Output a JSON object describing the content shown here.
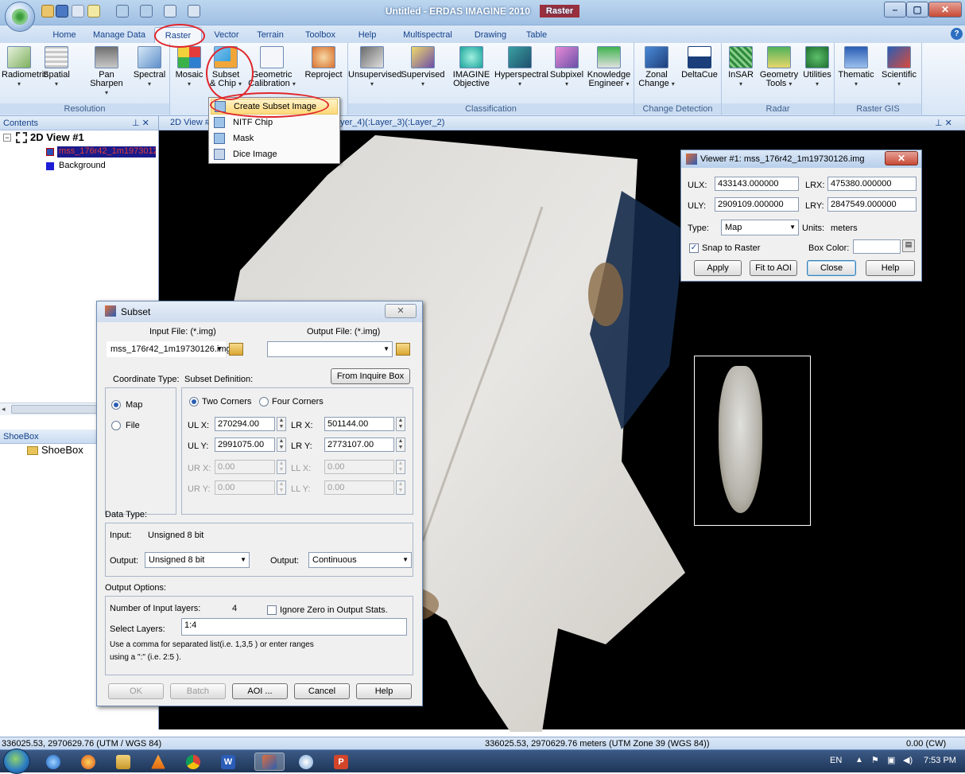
{
  "window": {
    "title": "Untitled - ERDAS IMAGINE 2010",
    "context_tab": "Raster"
  },
  "tabs": [
    "Home",
    "Manage Data",
    "Raster",
    "Vector",
    "Terrain",
    "Toolbox",
    "Help",
    "Multispectral",
    "Drawing",
    "Table"
  ],
  "ribbon": {
    "groups": {
      "resolution": "Resolution",
      "classification": "Classification",
      "change_detection": "Change Detection",
      "radar": "Radar",
      "raster_gis": "Raster GIS"
    },
    "buttons": {
      "radiometric": "Radiometric",
      "spatial": "Spatial",
      "pan": "Pan",
      "sharpen": "Sharpen",
      "spectral": "Spectral",
      "mosaic": "Mosaic",
      "subset": "Subset",
      "chip": "& Chip",
      "geometric": "Geometric",
      "calibration": "Calibration",
      "reproject": "Reproject",
      "unsupervised": "Unsupervised",
      "supervised": "Supervised",
      "imagine": "IMAGINE",
      "objective": "Objective",
      "hyperspectral": "Hyperspectral",
      "subpixel": "Subpixel",
      "knowledge": "Knowledge",
      "engineer": "Engineer",
      "zonal": "Zonal",
      "change": "Change",
      "deltacue": "DeltaCue",
      "insar": "InSAR",
      "geometry": "Geometry",
      "tools": "Tools",
      "utilities": "Utilities",
      "thematic": "Thematic",
      "scientific": "Scientific"
    }
  },
  "subset_menu": [
    "Create Subset Image",
    "NITF Chip",
    "Mask",
    "Dice Image"
  ],
  "contents": {
    "header": "Contents",
    "view": "2D View #1",
    "layer": "mss_176r42_1m19730126",
    "background": "Background"
  },
  "view_tab": {
    "name": "2D View #",
    "layers": "yer_4)(:Layer_3)(:Layer_2)"
  },
  "shoebox": {
    "header": "ShoeBox",
    "item": "ShoeBox"
  },
  "viewer": {
    "title": "Viewer #1: mss_176r42_1m19730126.img",
    "ulx_label": "ULX:",
    "ulx": "433143.000000",
    "lrx_label": "LRX:",
    "lrx": "475380.000000",
    "uly_label": "ULY:",
    "uly": "2909109.000000",
    "lry_label": "LRY:",
    "lry": "2847549.000000",
    "type_label": "Type:",
    "type": "Map",
    "units_label": "Units:",
    "units": "meters",
    "snap": "Snap to Raster",
    "box_color": "Box Color:",
    "apply": "Apply",
    "fit": "Fit to AOI",
    "close": "Close",
    "help": "Help"
  },
  "subset": {
    "title": "Subset",
    "input_label": "Input File: (*.img)",
    "output_label": "Output File: (*.img)",
    "input_value": "mss_176r42_1m19730126.img",
    "output_value": "",
    "coord_type": "Coordinate Type:",
    "subset_def": "Subset Definition:",
    "from_inquire": "From Inquire Box",
    "map": "Map",
    "file": "File",
    "two_corners": "Two Corners",
    "four_corners": "Four Corners",
    "ulx_label": "UL X:",
    "ulx": "270294.00",
    "lrx_label": "LR X:",
    "lrx": "501144.00",
    "uly_label": "UL Y:",
    "uly": "2991075.00",
    "lry_label": "LR Y:",
    "lry": "2773107.00",
    "urx_label": "UR X:",
    "urx": "0.00",
    "llx_label": "LL X:",
    "llx": "0.00",
    "ury_label": "UR Y:",
    "ury": "0.00",
    "lly_label": "LL Y:",
    "lly": "0.00",
    "data_type": "Data Type:",
    "input_type_label": "Input:",
    "input_type": "Unsigned 8 bit",
    "output_type_label": "Output:",
    "output_type": "Unsigned 8 bit",
    "output2_label": "Output:",
    "output2": "Continuous",
    "output_options": "Output Options:",
    "num_layers_label": "Number of Input layers:",
    "num_layers": "4",
    "ignore_zero": "Ignore Zero in Output Stats.",
    "select_layers_label": "Select Layers:",
    "select_layers": "1:4",
    "hint1": "Use a comma for separated list(i.e. 1,3,5 ) or enter ranges",
    "hint2": "using a \":\" (i.e. 2:5 ).",
    "ok": "OK",
    "batch": "Batch",
    "aoi": "AOI ...",
    "cancel": "Cancel",
    "help": "Help"
  },
  "status": {
    "left": "336025.53, 2970629.76  (UTM / WGS 84)",
    "center": "336025.53, 2970629.76 meters (UTM Zone 39 (WGS 84))",
    "right": "0.00 (CW)"
  },
  "taskbar": {
    "lang": "EN",
    "time": "7:53 PM"
  }
}
